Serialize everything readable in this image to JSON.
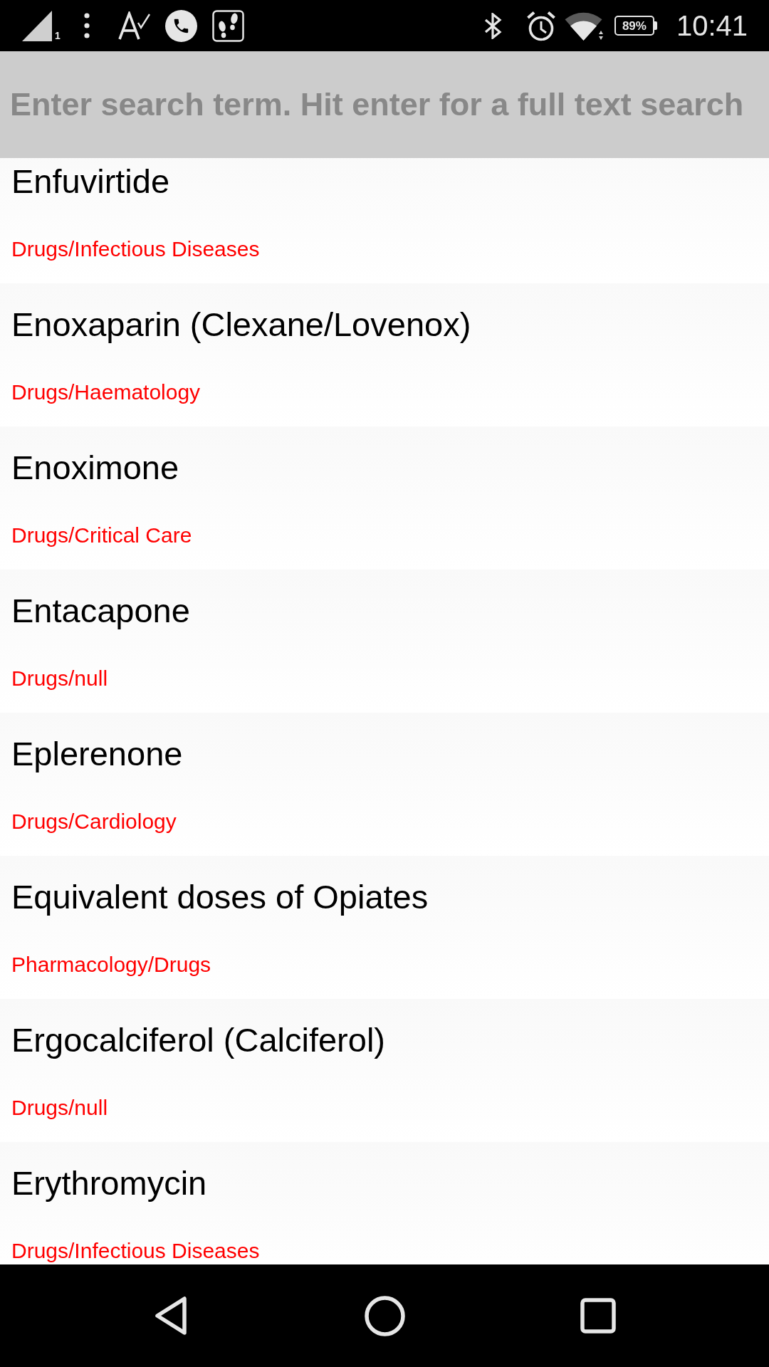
{
  "status_bar": {
    "sim_label": "1",
    "battery_text": "89%",
    "time": "10:41"
  },
  "search": {
    "placeholder": "Enter search term. Hit enter for a full text search"
  },
  "items": [
    {
      "title": "Enfuvirtide",
      "category": "Drugs/Infectious Diseases"
    },
    {
      "title": "Enoxaparin (Clexane/Lovenox)",
      "category": "Drugs/Haematology"
    },
    {
      "title": "Enoximone",
      "category": "Drugs/Critical Care"
    },
    {
      "title": "Entacapone",
      "category": "Drugs/null"
    },
    {
      "title": "Eplerenone",
      "category": "Drugs/Cardiology"
    },
    {
      "title": "Equivalent doses of Opiates",
      "category": "Pharmacology/Drugs"
    },
    {
      "title": "Ergocalciferol (Calciferol)",
      "category": "Drugs/null"
    },
    {
      "title": "Erythromycin",
      "category": "Drugs/Infectious Diseases"
    }
  ]
}
